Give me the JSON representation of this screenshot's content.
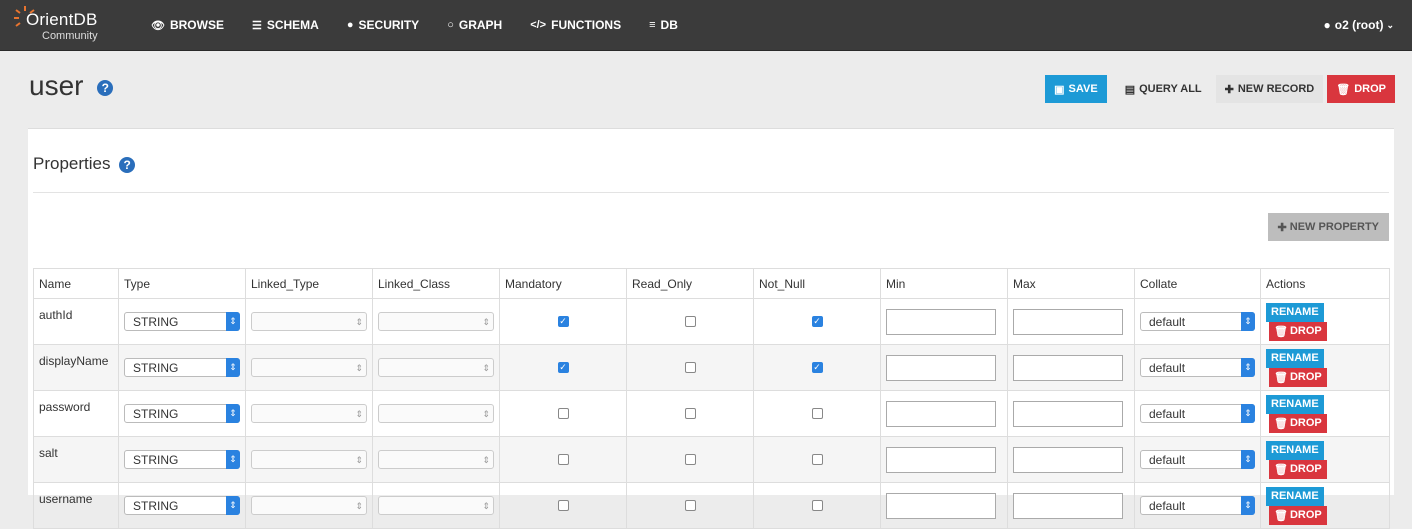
{
  "nav": {
    "logo_text": "OrientDB",
    "logo_sub": "Community",
    "items": [
      {
        "label": "BROWSE",
        "icon": "eye-icon"
      },
      {
        "label": "SCHEMA",
        "icon": "list-icon"
      },
      {
        "label": "SECURITY",
        "icon": "user-icon"
      },
      {
        "label": "GRAPH",
        "icon": "circle-icon"
      },
      {
        "label": "FUNCTIONS",
        "icon": "code-icon"
      },
      {
        "label": "DB",
        "icon": "database-icon"
      }
    ],
    "user_label": "o2 (root)"
  },
  "page": {
    "title": "user",
    "help": "?",
    "actions": {
      "save": "SAVE",
      "query_all": "QUERY ALL",
      "new_record": "NEW RECORD",
      "drop": "DROP"
    }
  },
  "properties": {
    "title": "Properties",
    "new_property": "NEW PROPERTY",
    "columns": [
      "Name",
      "Type",
      "Linked_Type",
      "Linked_Class",
      "Mandatory",
      "Read_Only",
      "Not_Null",
      "Min",
      "Max",
      "Collate",
      "Actions"
    ],
    "rows": [
      {
        "name": "authId",
        "type": "STRING",
        "mandatory": true,
        "read_only": false,
        "not_null": true,
        "collate": "default"
      },
      {
        "name": "displayName",
        "type": "STRING",
        "mandatory": true,
        "read_only": false,
        "not_null": true,
        "collate": "default"
      },
      {
        "name": "password",
        "type": "STRING",
        "mandatory": false,
        "read_only": false,
        "not_null": false,
        "collate": "default"
      },
      {
        "name": "salt",
        "type": "STRING",
        "mandatory": false,
        "read_only": false,
        "not_null": false,
        "collate": "default"
      },
      {
        "name": "username",
        "type": "STRING",
        "mandatory": false,
        "read_only": false,
        "not_null": false,
        "collate": "default"
      }
    ],
    "row_actions": {
      "rename": "RENAME",
      "drop": "DROP"
    }
  },
  "colors": {
    "nav_bg": "#3b3b3b",
    "primary": "#1d9ad6",
    "danger": "#d9363e",
    "accent": "#e8742f"
  }
}
